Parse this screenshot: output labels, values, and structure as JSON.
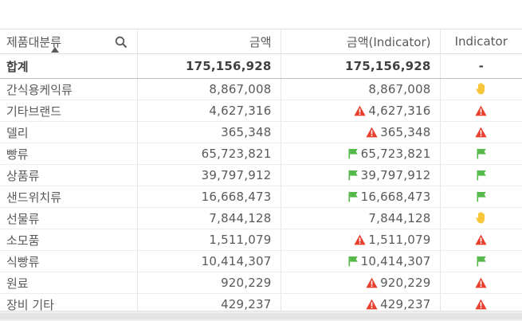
{
  "header": {
    "dim": "제품대분류",
    "col_amount": "금액",
    "col_amount_ind": "금액(Indicator)",
    "col_indicator": "Indicator"
  },
  "total": {
    "label": "합계",
    "amount": "175,156,928",
    "amount_ind": "175,156,928",
    "indicator": "-"
  },
  "colors": {
    "warning": "#f8c63a",
    "alert": "#e8402e",
    "good": "#54b948"
  },
  "rows": [
    {
      "label": "간식용케익류",
      "amount": "8,867,008",
      "amount_ind": "8,867,008",
      "status": "yellow",
      "icon": "hand-icon"
    },
    {
      "label": "기타브랜드",
      "amount": "4,627,316",
      "amount_ind": "4,627,316",
      "status": "red",
      "icon": "warning-triangle-icon"
    },
    {
      "label": "델리",
      "amount": "365,348",
      "amount_ind": "365,348",
      "status": "red",
      "icon": "warning-triangle-icon"
    },
    {
      "label": "빵류",
      "amount": "65,723,821",
      "amount_ind": "65,723,821",
      "status": "green",
      "icon": "flag-icon"
    },
    {
      "label": "상품류",
      "amount": "39,797,912",
      "amount_ind": "39,797,912",
      "status": "green",
      "icon": "flag-icon"
    },
    {
      "label": "샌드위치류",
      "amount": "16,668,473",
      "amount_ind": "16,668,473",
      "status": "green",
      "icon": "flag-icon"
    },
    {
      "label": "선물류",
      "amount": "7,844,128",
      "amount_ind": "7,844,128",
      "status": "yellow",
      "icon": "hand-icon"
    },
    {
      "label": "소모품",
      "amount": "1,511,079",
      "amount_ind": "1,511,079",
      "status": "red",
      "icon": "warning-triangle-icon"
    },
    {
      "label": "식빵류",
      "amount": "10,414,307",
      "amount_ind": "10,414,307",
      "status": "green",
      "icon": "flag-icon"
    },
    {
      "label": "원료",
      "amount": "920,229",
      "amount_ind": "920,229",
      "status": "red",
      "icon": "warning-triangle-icon"
    },
    {
      "label": "장비 기타",
      "amount": "429,237",
      "amount_ind": "429,237",
      "status": "red",
      "icon": "warning-triangle-icon"
    }
  ]
}
